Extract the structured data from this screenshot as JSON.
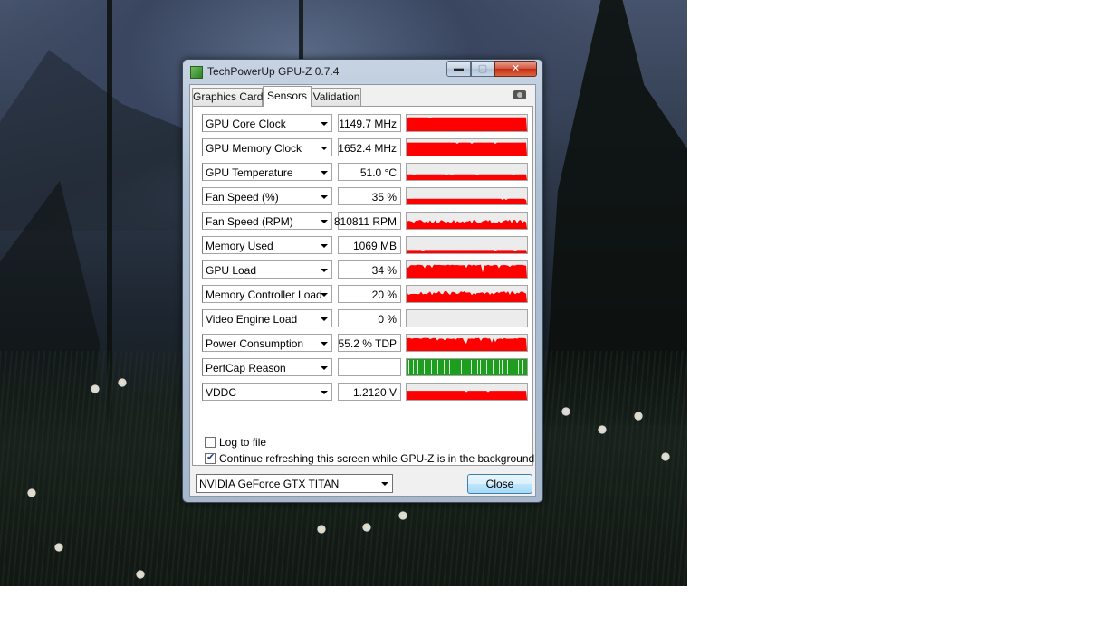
{
  "window": {
    "title": "TechPowerUp GPU-Z 0.7.4",
    "caption_buttons": {
      "minimize": "▬",
      "maximize": "▢",
      "close": "✕"
    }
  },
  "tabs": [
    {
      "label": "Graphics Card",
      "active": false
    },
    {
      "label": "Sensors",
      "active": true
    },
    {
      "label": "Validation",
      "active": false
    }
  ],
  "icons": {
    "camera": "camera-icon"
  },
  "colors": {
    "graph_fill": "#ff0000",
    "perfcap_fill": "#1e9e1e",
    "graph_bg": "#ececec"
  },
  "sensors": [
    {
      "name": "GPU Core Clock",
      "value": "1149.7 MHz",
      "level": 0.85,
      "pattern": "high-flat"
    },
    {
      "name": "GPU Memory Clock",
      "value": "1652.4 MHz",
      "level": 0.8,
      "pattern": "high-flat"
    },
    {
      "name": "GPU Temperature",
      "value": "51.0 °C",
      "level": 0.35,
      "pattern": "low-flat"
    },
    {
      "name": "Fan Speed (%)",
      "value": "35 %",
      "level": 0.35,
      "pattern": "low-flat"
    },
    {
      "name": "Fan Speed (RPM)",
      "value": "810811 RPM",
      "level": 0.45,
      "pattern": "noisy"
    },
    {
      "name": "Memory Used",
      "value": "1069 MB",
      "level": 0.2,
      "pattern": "low-flat"
    },
    {
      "name": "GPU Load",
      "value": "34 %",
      "level": 0.8,
      "pattern": "spiky"
    },
    {
      "name": "Memory Controller Load",
      "value": "20 %",
      "level": 0.55,
      "pattern": "noisy"
    },
    {
      "name": "Video Engine Load",
      "value": "0 %",
      "level": 0,
      "pattern": "empty"
    },
    {
      "name": "Power Consumption",
      "value": "55.2 % TDP",
      "level": 0.8,
      "pattern": "spiky"
    },
    {
      "name": "PerfCap Reason",
      "value": "",
      "level": 1,
      "pattern": "perfcap"
    },
    {
      "name": "VDDC",
      "value": "1.2120 V",
      "level": 0.55,
      "pattern": "low-flat"
    }
  ],
  "options": {
    "log_to_file": {
      "label": "Log to file",
      "checked": false
    },
    "continue_refreshing": {
      "label": "Continue refreshing this screen while GPU-Z is in the background",
      "checked": true
    }
  },
  "gpu_selector": {
    "selected": "NVIDIA GeForce GTX TITAN"
  },
  "buttons": {
    "close": "Close"
  }
}
